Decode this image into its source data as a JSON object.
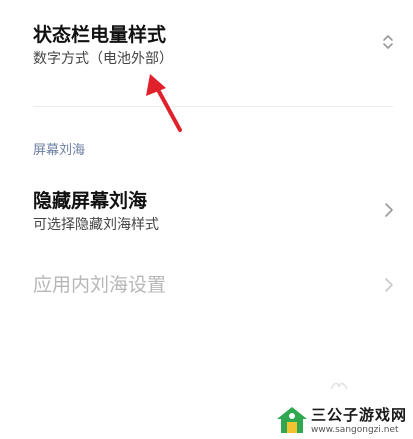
{
  "battery_style": {
    "title": "状态栏电量样式",
    "subtitle": "数字方式（电池外部）",
    "chevron_icon": "chevron-up-down-icon"
  },
  "notch_section": {
    "header": "屏幕刘海",
    "hide_notch": {
      "title": "隐藏屏幕刘海",
      "subtitle": "可选择隐藏刘海样式",
      "chevron_icon": "chevron-right-icon"
    },
    "in_app_notch": {
      "title": "应用内刘海设置",
      "chevron_icon": "chevron-right-icon"
    }
  },
  "annotation": {
    "arrow_color": "#e0202a",
    "icon": "red-arrow-icon"
  },
  "watermark": {
    "name": "三公子游戏网",
    "url": "www.sangongzi.net",
    "logo_icon": "house-logo-icon",
    "logo_green": "#2fa84f",
    "logo_yellow": "#f2c230"
  }
}
